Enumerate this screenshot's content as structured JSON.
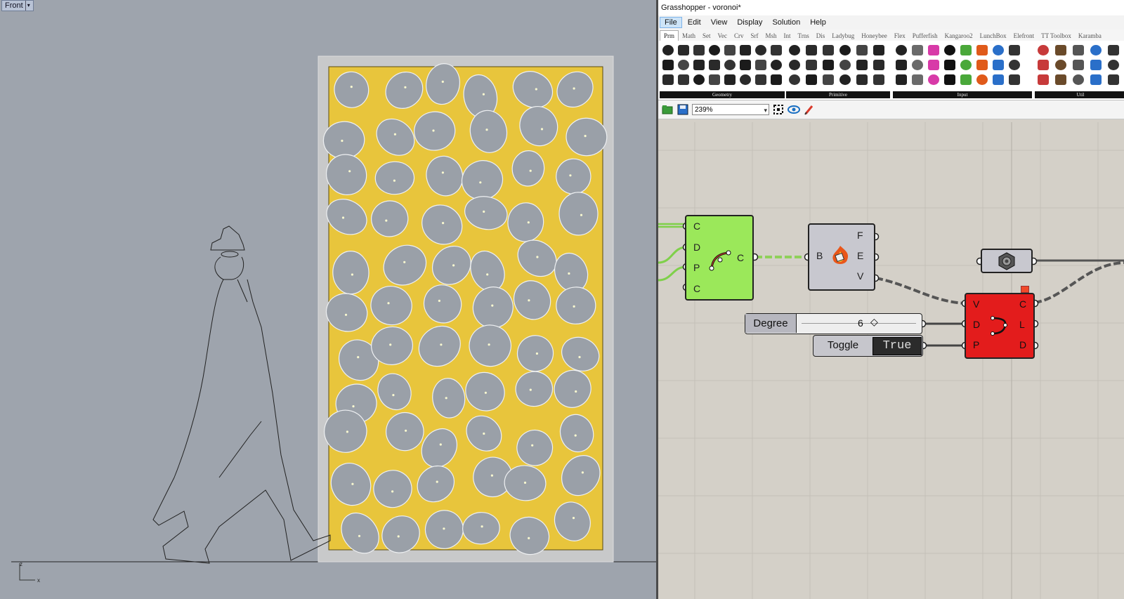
{
  "rhino": {
    "viewport_label": "Front",
    "axis_z": "z",
    "axis_x": "x"
  },
  "gh": {
    "title": "Grasshopper - voronoi*",
    "menu": [
      "File",
      "Edit",
      "View",
      "Display",
      "Solution",
      "Help"
    ],
    "tabs": [
      "Prm",
      "Math",
      "Set",
      "Vec",
      "Crv",
      "Srf",
      "Msh",
      "Int",
      "Trns",
      "Dis",
      "Ladybug",
      "Honeybee",
      "Flex",
      "Pufferfish",
      "Kangaroo2",
      "LunchBox",
      "Elefront",
      "TT Toolbox",
      "Karamba"
    ],
    "ribbon_panels": [
      "Geometry",
      "Primitive",
      "Input",
      "Util"
    ],
    "zoom": "239%",
    "components": {
      "curve_comp": {
        "inputs": [
          "C",
          "D",
          "P",
          "C"
        ],
        "outputs": [
          "C"
        ],
        "color": "#9be85a"
      },
      "brep_edges": {
        "inputs": [
          "B"
        ],
        "outputs": [
          "F",
          "E",
          "V"
        ],
        "color": "#c6c6cc"
      },
      "hex_param": {
        "color": "#c6c6cc"
      },
      "nurbs_curve": {
        "inputs": [
          "V",
          "D",
          "P"
        ],
        "outputs": [
          "C",
          "L",
          "D"
        ],
        "color": "#e01c1c"
      }
    },
    "slider": {
      "name": "Degree",
      "value": "6"
    },
    "toggle": {
      "name": "Toggle",
      "value": "True"
    }
  }
}
